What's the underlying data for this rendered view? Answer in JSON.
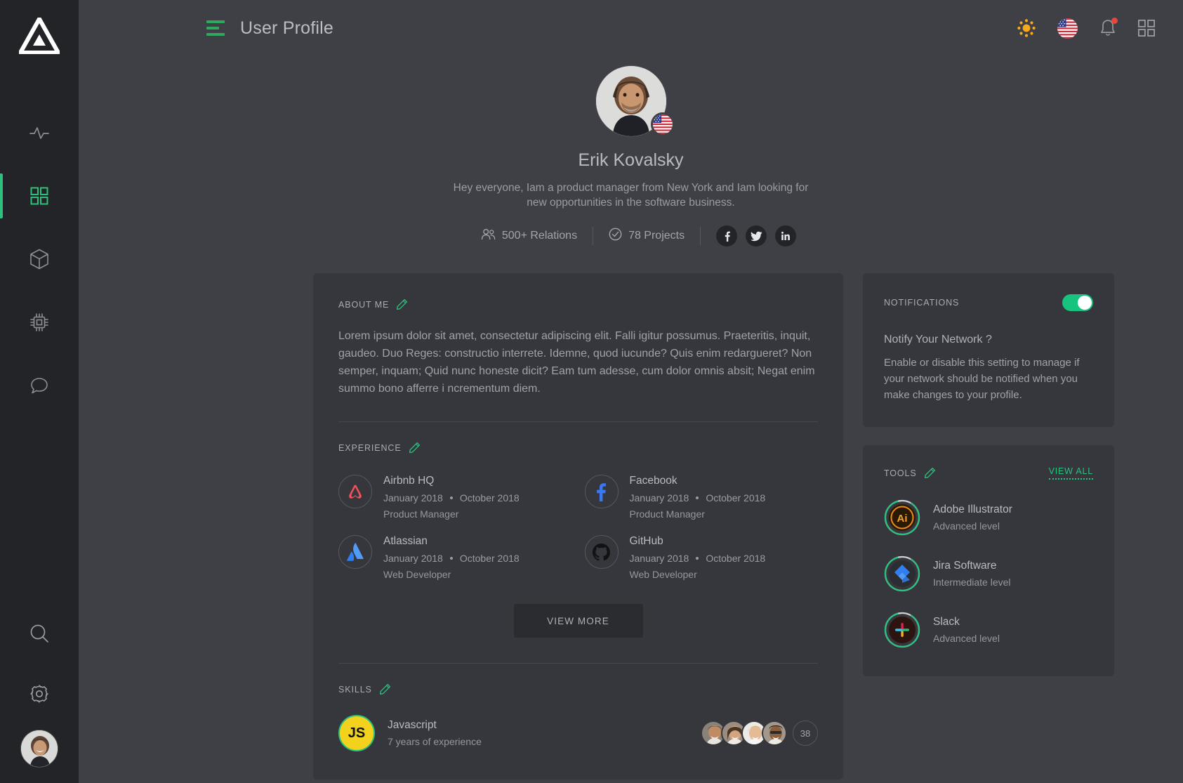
{
  "theme": {
    "bg": "#3e4046",
    "rail_bg": "#232427",
    "card_bg": "#35373c",
    "accent_green": "#2dc17f",
    "text_primary": "#b9bbc0",
    "text_muted": "#95979e",
    "alert_red": "#e8453c"
  },
  "rail": {
    "logo_name": "triangle-logo",
    "items": [
      {
        "name": "activity-icon",
        "label": "Activity",
        "active": false
      },
      {
        "name": "dashboard-grid-icon",
        "label": "Dashboard",
        "active": true
      },
      {
        "name": "cube-icon",
        "label": "Packages",
        "active": false
      },
      {
        "name": "chip-icon",
        "label": "Devices",
        "active": false
      },
      {
        "name": "chat-bubble-icon",
        "label": "Messages",
        "active": false
      }
    ],
    "bottom_items": [
      {
        "name": "search-icon",
        "label": "Search"
      },
      {
        "name": "gear-icon",
        "label": "Settings"
      }
    ],
    "avatar_label": "Erik Kovalsky"
  },
  "topbar": {
    "menu_label": "Toggle menu",
    "title": "User Profile",
    "icons": [
      {
        "name": "sun-icon",
        "label": "Theme"
      },
      {
        "name": "us-flag-icon",
        "label": "English (US)"
      },
      {
        "name": "bell-icon",
        "label": "Notifications",
        "has_dot": true
      },
      {
        "name": "apps-grid-icon",
        "label": "Apps"
      }
    ]
  },
  "hero": {
    "avatar_label": "Erik Kovalsky avatar",
    "flag_label": "United States",
    "name": "Erik Kovalsky",
    "bio": "Hey everyone,  Iam a product manager from New York and Iam looking for new opportunities in the software business.",
    "stats": [
      {
        "icon": "people-icon",
        "value": "500+ Relations"
      },
      {
        "icon": "check-circle-icon",
        "value": "78 Projects"
      }
    ],
    "socials": [
      {
        "name": "facebook-icon",
        "label": "Facebook"
      },
      {
        "name": "twitter-icon",
        "label": "Twitter"
      },
      {
        "name": "linkedin-icon",
        "label": "LinkedIn"
      }
    ]
  },
  "about": {
    "title": "ABOUT ME",
    "edit_label": "Edit about me",
    "text": "Lorem ipsum dolor sit amet, consectetur adipiscing elit. Falli igitur possumus. Praeteritis, inquit, gaudeo. Duo Reges: constructio interrete. Idemne, quod iucunde? Quis enim redargueret? Non semper, inquam; Quid nunc honeste dicit? Eam tum adesse, cum dolor omnis absit; Negat enim summo bono afferre i ncrementum diem."
  },
  "experience": {
    "title": "EXPERIENCE",
    "edit_label": "Edit experience",
    "items": [
      {
        "company": "Airbnb HQ",
        "logo": "airbnb-icon",
        "start": "January 2018",
        "end": "October 2018",
        "role": "Product Manager"
      },
      {
        "company": "Facebook",
        "logo": "facebook-icon",
        "start": "January 2018",
        "end": "October 2018",
        "role": "Product Manager"
      },
      {
        "company": "Atlassian",
        "logo": "atlassian-icon",
        "start": "January 2018",
        "end": "October 2018",
        "role": "Web Developer"
      },
      {
        "company": "GitHub",
        "logo": "github-icon",
        "start": "January 2018",
        "end": "October 2018",
        "role": "Web Developer"
      }
    ],
    "view_more_label": "VIEW MORE"
  },
  "skills": {
    "title": "SKILLS",
    "edit_label": "Edit skills",
    "items": [
      {
        "badge_text": "JS",
        "name": "Javascript",
        "experience": "7 years of experience",
        "people_count": 4,
        "more_count": "38"
      }
    ]
  },
  "notifications": {
    "title": "NOTIFICATIONS",
    "toggle_on": true,
    "toggle_label": "Notifications toggle",
    "question": "Notify Your Network ?",
    "description": "Enable or disable this setting to manage if your network should be notified when you make changes to your profile."
  },
  "tools": {
    "title": "TOOLS",
    "edit_label": "Edit tools",
    "view_all_label": "VIEW ALL",
    "items": [
      {
        "name": "Adobe Illustrator",
        "logo": "adobe-illustrator-icon",
        "level": "Advanced level",
        "progress": 88
      },
      {
        "name": "Jira Software",
        "logo": "jira-icon",
        "level": "Intermediate level",
        "progress": 88
      },
      {
        "name": "Slack",
        "logo": "slack-icon",
        "level": "Advanced level",
        "progress": 88
      }
    ]
  }
}
